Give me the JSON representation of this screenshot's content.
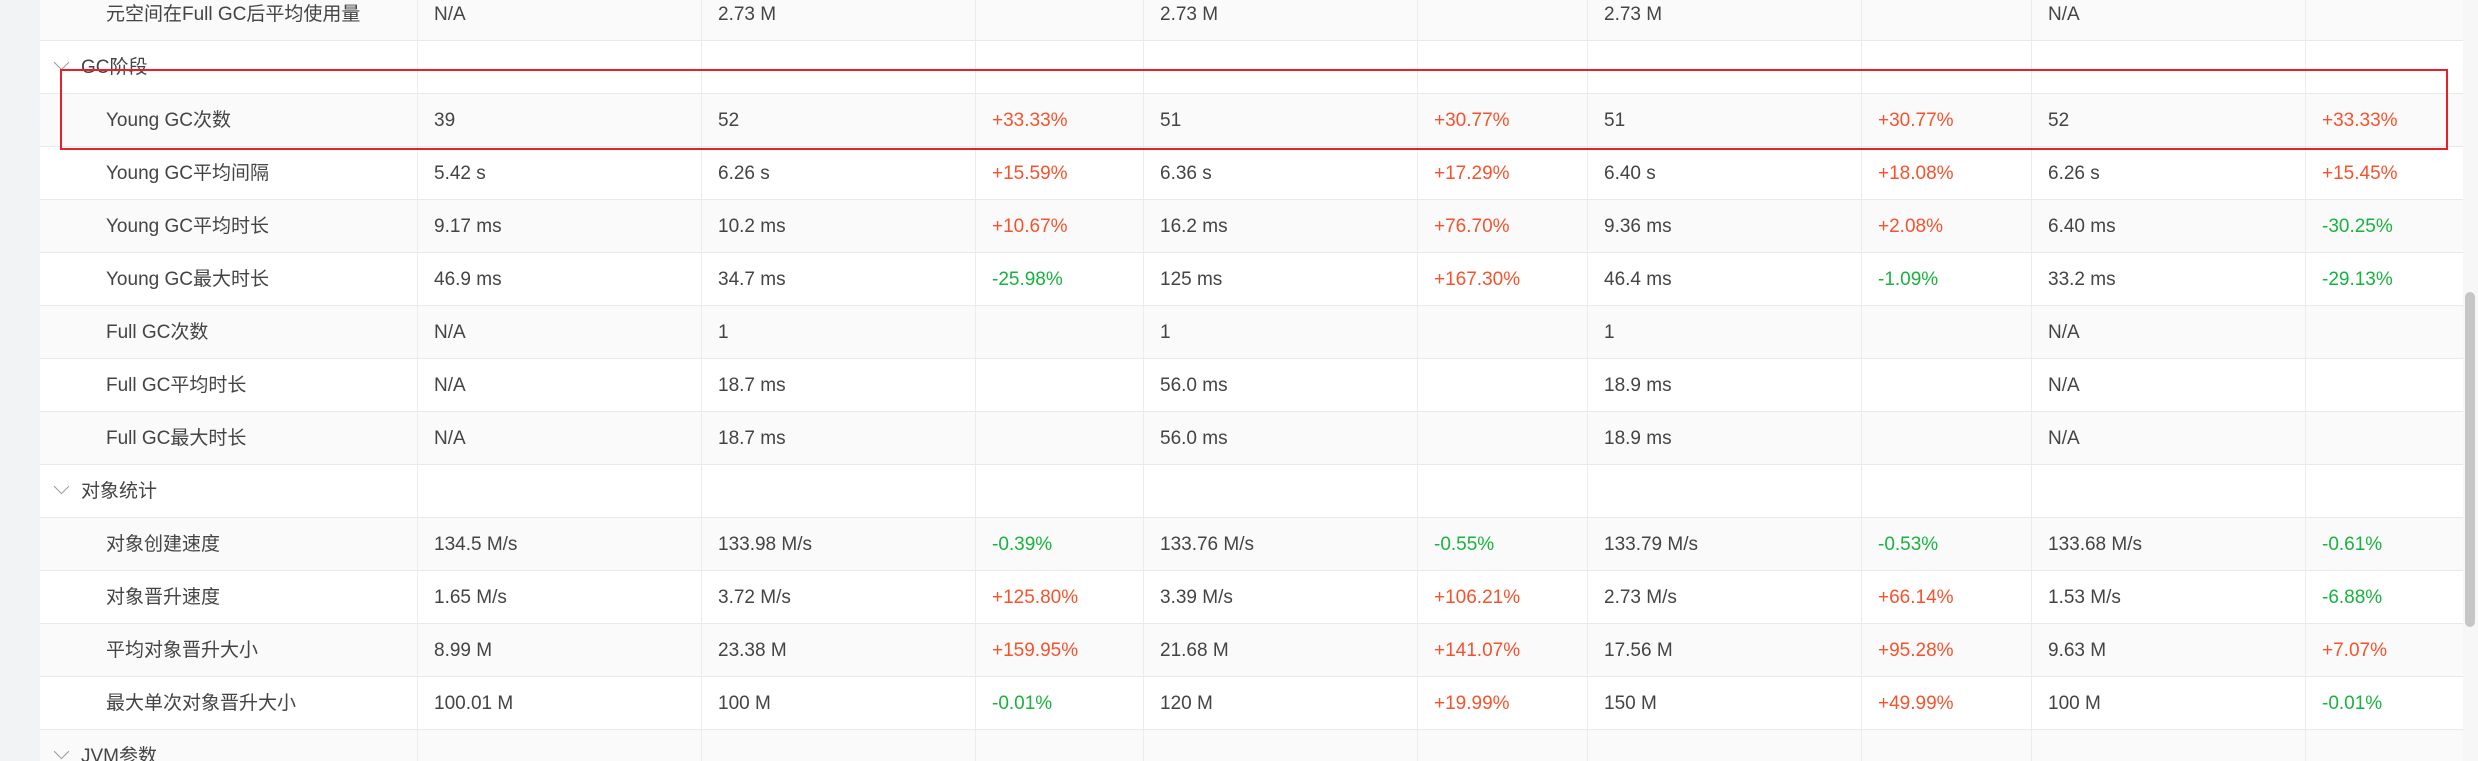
{
  "rows": [
    {
      "type": "metric",
      "name": "元空间在Full GC后平均使用量",
      "cells": [
        "N/A",
        "2.73 M",
        "",
        "2.73 M",
        "",
        "2.73 M",
        "",
        "N/A",
        ""
      ]
    },
    {
      "type": "group",
      "name": "GC阶段"
    },
    {
      "type": "metric",
      "name": "Young GC次数",
      "cells": [
        "39",
        "52",
        "+33.33%",
        "51",
        "+30.77%",
        "51",
        "+30.77%",
        "52",
        "+33.33%"
      ]
    },
    {
      "type": "metric",
      "name": "Young GC平均间隔",
      "cells": [
        "5.42 s",
        "6.26 s",
        "+15.59%",
        "6.36 s",
        "+17.29%",
        "6.40 s",
        "+18.08%",
        "6.26 s",
        "+15.45%"
      ]
    },
    {
      "type": "metric",
      "name": "Young GC平均时长",
      "cells": [
        "9.17 ms",
        "10.2 ms",
        "+10.67%",
        "16.2 ms",
        "+76.70%",
        "9.36 ms",
        "+2.08%",
        "6.40 ms",
        "-30.25%"
      ]
    },
    {
      "type": "metric",
      "name": "Young GC最大时长",
      "cells": [
        "46.9 ms",
        "34.7 ms",
        "-25.98%",
        "125 ms",
        "+167.30%",
        "46.4 ms",
        "-1.09%",
        "33.2 ms",
        "-29.13%"
      ]
    },
    {
      "type": "metric",
      "name": "Full GC次数",
      "cells": [
        "N/A",
        "1",
        "",
        "1",
        "",
        "1",
        "",
        "N/A",
        ""
      ]
    },
    {
      "type": "metric",
      "name": "Full GC平均时长",
      "cells": [
        "N/A",
        "18.7 ms",
        "",
        "56.0 ms",
        "",
        "18.9 ms",
        "",
        "N/A",
        ""
      ]
    },
    {
      "type": "metric",
      "name": "Full GC最大时长",
      "cells": [
        "N/A",
        "18.7 ms",
        "",
        "56.0 ms",
        "",
        "18.9 ms",
        "",
        "N/A",
        ""
      ]
    },
    {
      "type": "group",
      "name": "对象统计"
    },
    {
      "type": "metric",
      "name": "对象创建速度",
      "cells": [
        "134.5 M/s",
        "133.98 M/s",
        "-0.39%",
        "133.76 M/s",
        "-0.55%",
        "133.79 M/s",
        "-0.53%",
        "133.68 M/s",
        "-0.61%"
      ]
    },
    {
      "type": "metric",
      "name": "对象晋升速度",
      "cells": [
        "1.65 M/s",
        "3.72 M/s",
        "+125.80%",
        "3.39 M/s",
        "+106.21%",
        "2.73 M/s",
        "+66.14%",
        "1.53 M/s",
        "-6.88%"
      ]
    },
    {
      "type": "metric",
      "name": "平均对象晋升大小",
      "cells": [
        "8.99 M",
        "23.38 M",
        "+159.95%",
        "21.68 M",
        "+141.07%",
        "17.56 M",
        "+95.28%",
        "9.63 M",
        "+7.07%"
      ]
    },
    {
      "type": "metric",
      "name": "最大单次对象晋升大小",
      "cells": [
        "100.01 M",
        "100 M",
        "-0.01%",
        "120 M",
        "+19.99%",
        "150 M",
        "+49.99%",
        "100 M",
        "-0.01%"
      ]
    },
    {
      "type": "group",
      "name": "JVM参数"
    }
  ]
}
